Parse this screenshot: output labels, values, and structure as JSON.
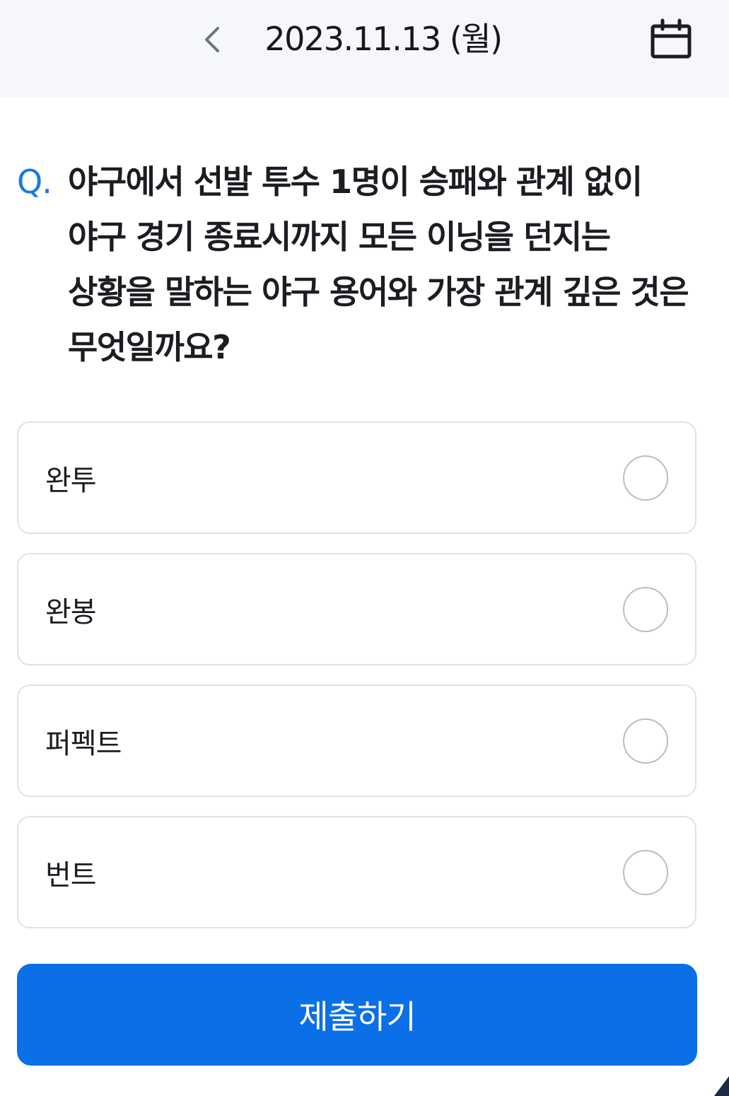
{
  "header": {
    "date": "2023.11.13 (월)",
    "back_icon": "chevron-left-icon",
    "calendar_icon": "calendar-icon"
  },
  "question": {
    "prefix": "Q.",
    "text": "야구에서 선발 투수 1명이 승패와 관계 없이 야구 경기 종료시까지 모든 이닝을 던지는 상황을 말하는 야구 용어와 가장 관계 깊은 것은 무엇일까요?"
  },
  "options": [
    {
      "label": "완투"
    },
    {
      "label": "완봉"
    },
    {
      "label": "퍼펙트"
    },
    {
      "label": "번트"
    }
  ],
  "submit": {
    "label": "제출하기"
  },
  "colors": {
    "accent": "#0b6fe8",
    "question_prefix": "#1779e8",
    "header_bg": "#f6f7fb",
    "option_border": "#dfe2e7",
    "radio_border": "#b9bec6"
  }
}
